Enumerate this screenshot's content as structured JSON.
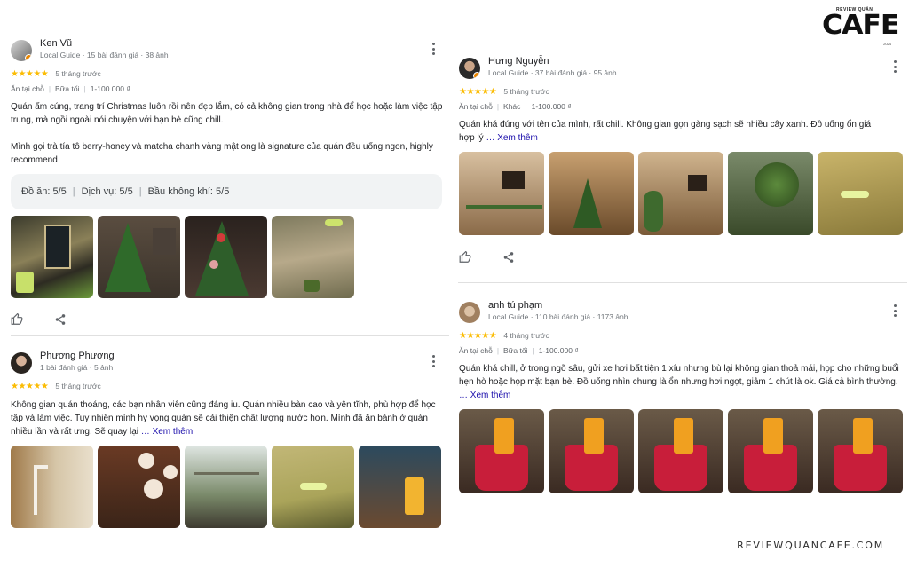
{
  "brand": {
    "small": "REVIEW QUÁN",
    "big": "CAFE",
    "year": "2024"
  },
  "watermark": "REVIEWQUANCAFE.COM",
  "reviews": [
    {
      "name": "Ken Vũ",
      "meta": "Local Guide · 15 bài đánh giá · 38 ảnh",
      "stars": "★★★★★",
      "date": "5 tháng trước",
      "tags": [
        "Ăn tại chỗ",
        "Bữa tối",
        "1-100.000 ₫"
      ],
      "text1": "Quán ấm cúng, trang trí Christmas luôn rồi nên đẹp lắm, có cả không gian trong nhà để học hoặc làm việc tập trung, mà ngồi ngoài nói chuyện với bạn bè cũng chill.",
      "text2": "Mình gọi trà tía tô berry-honey và matcha chanh vàng mật ong là signature của quán đều uống ngon, highly recommend",
      "scores": [
        "Đồ ăn: 5/5",
        "Dịch vụ: 5/5",
        "Bầu không khí: 5/5"
      ]
    },
    {
      "name": "Phương Phương",
      "meta": "1 bài đánh giá · 5 ảnh",
      "stars": "★★★★★",
      "date": "5 tháng trước",
      "text": "Không gian quán thoáng, các bạn nhân viên cũng đáng iu. Quán nhiều bàn cao và yên tĩnh, phù hợp để học tập và làm việc. Tuy nhiên mình hy vọng quán sẽ cải thiện chất lượng nước hơn. Mình đã ăn bánh ở quán nhiều lần và rất ưng. Sẽ quay lại",
      "more": "… Xem thêm"
    },
    {
      "name": "Hưng Nguyễn",
      "meta": "Local Guide · 37 bài đánh giá · 95 ảnh",
      "stars": "★★★★★",
      "date": "5 tháng trước",
      "tags": [
        "Ăn tại chỗ",
        "Khác",
        "1-100.000 ₫"
      ],
      "text": "Quán khá đúng với tên của mình, rất chill. Không gian gọn gàng sạch sẽ nhiều cây xanh. Đồ uống ổn giá hợp lý",
      "more": "… Xem thêm"
    },
    {
      "name": "anh tú phạm",
      "meta": "Local Guide · 110 bài đánh giá · 1173 ảnh",
      "stars": "★★★★★",
      "date": "4 tháng trước",
      "tags": [
        "Ăn tại chỗ",
        "Bữa tối",
        "1-100.000 ₫"
      ],
      "text": "Quán khá chill, ở trong ngõ sâu, gửi xe hơi bất tiện 1 xíu nhưng bù lại không gian thoả mái, họp cho những buổi hẹn hò hoặc họp mặt bạn bè. Đồ uống nhìn chung là ổn nhưng hơi ngọt, giảm 1 chút là ok. Giá cả bình thường.",
      "more": "… Xem thêm"
    }
  ],
  "icons": {
    "like": "thumbs-up-icon",
    "share": "share-icon",
    "menu": "more-vert-icon"
  }
}
